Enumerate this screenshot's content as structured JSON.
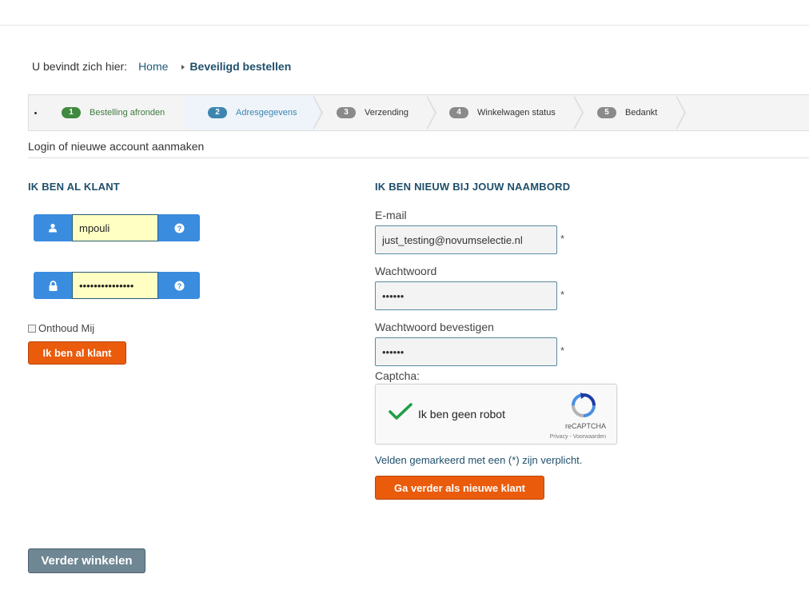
{
  "breadcrumb": {
    "prefix": "U bevindt zich hier:",
    "home": "Home",
    "current": "Beveiligd bestellen"
  },
  "steps": [
    {
      "num": "1",
      "label": "Bestelling afronden",
      "state": "done",
      "color": "#3f8a3f"
    },
    {
      "num": "2",
      "label": "Adresgegevens",
      "state": "active",
      "color": "#3d85b1"
    },
    {
      "num": "3",
      "label": "Verzending",
      "state": "pending",
      "color": "#8a8a8a"
    },
    {
      "num": "4",
      "label": "Winkelwagen status",
      "state": "pending",
      "color": "#8a8a8a"
    },
    {
      "num": "5",
      "label": "Bedankt",
      "state": "pending",
      "color": "#8a8a8a"
    }
  ],
  "section_title": "Login of nieuwe account aanmaken",
  "existing": {
    "heading": "IK BEN AL KLANT",
    "username": "mpouli",
    "password": "•••••••••••••••",
    "remember_label": "Onthoud Mij",
    "submit_label": "Ik ben al klant",
    "icons": [
      "user-icon",
      "lock-icon",
      "help-icon"
    ]
  },
  "new_customer": {
    "heading": "IK BEN NIEUW BIJ JOUW NAAMBORD",
    "email_label": "E-mail",
    "email_value": "just_testing@novumselectie.nl",
    "password_label": "Wachtwoord",
    "password_value": "••••••",
    "confirm_label": "Wachtwoord bevestigen",
    "confirm_value": "••••••",
    "required_mark": "*",
    "captcha_label": "Captcha:",
    "captcha_text": "Ik ben geen robot",
    "captcha_brand": "reCAPTCHA",
    "captcha_terms": "Privacy - Voorwaarden",
    "required_note": "Velden gemarkeerd met een (*) zijn verplicht.",
    "submit_label": "Ga verder als nieuwe klant"
  },
  "continue_shopping": "Verder winkelen",
  "colors": {
    "accent_orange": "#ea5b0c",
    "addon_blue": "#3a8cdf",
    "heading_blue": "#1f4f6b",
    "input_yellow": "#ffffc4"
  }
}
